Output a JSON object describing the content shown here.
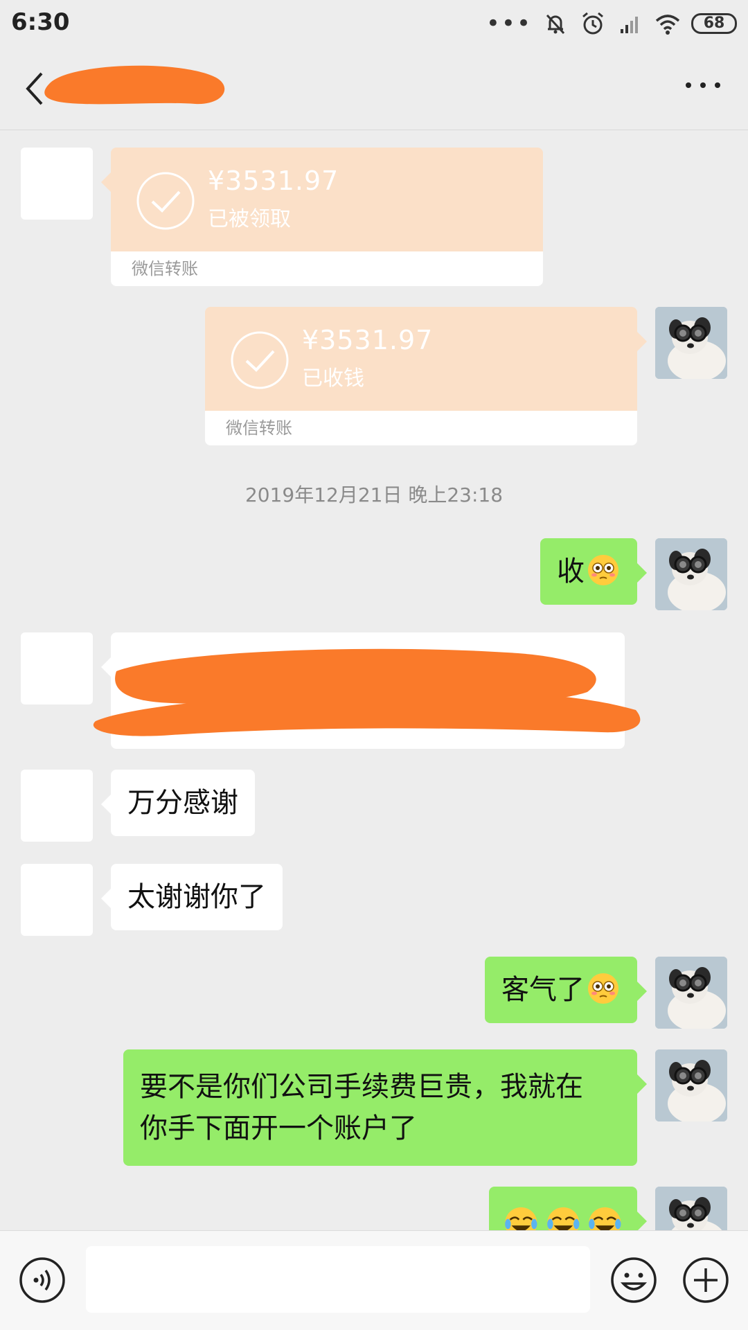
{
  "status_bar": {
    "time": "6:30",
    "dots": "•••",
    "battery": "68"
  },
  "header": {
    "title_redacted": true
  },
  "messages": {
    "transfer_1": {
      "amount": "¥3531.97",
      "status": "已被领取",
      "footer": "微信转账"
    },
    "transfer_2": {
      "amount": "¥3531.97",
      "status": "已收钱",
      "footer": "微信转账"
    },
    "timestamp": "2019年12月21日 晚上23:18",
    "msg_shou": "收",
    "msg_thanks_1": "万分感谢",
    "msg_thanks_2": "太谢谢你了",
    "msg_welcome": "客气了",
    "msg_long_line1": "要不是你们公司手续费巨贵，我就在",
    "msg_long_line2": "你手下面开一个账户了"
  },
  "colors": {
    "background": "#ededed",
    "green_bubble": "#95ec69",
    "transfer": "#fbe0c8",
    "redaction": "#fa7a2a"
  },
  "icons": [
    "back-icon",
    "more-icon",
    "check-icon",
    "voice-icon",
    "emoji-icon",
    "plus-icon",
    "avatar-dog",
    "flushed-emoji",
    "crying-laugh-emoji"
  ]
}
